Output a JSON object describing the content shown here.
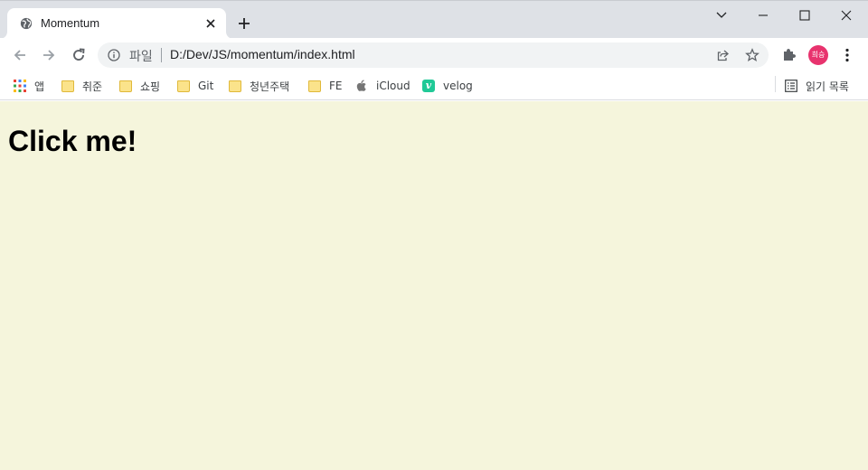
{
  "tab": {
    "title": "Momentum",
    "favicon": "globe-icon",
    "close": "close-icon"
  },
  "toolbar": {
    "scheme_label": "파일",
    "url": "D:/Dev/JS/momentum/index.html",
    "avatar_text": "희승",
    "avatar_color": "#e8336e"
  },
  "bookmarks": [
    {
      "label": "앱",
      "icon": "apps-grid-icon"
    },
    {
      "label": "취준",
      "icon": "folder-icon"
    },
    {
      "label": "쇼핑",
      "icon": "folder-icon"
    },
    {
      "label": "Git",
      "icon": "folder-icon"
    },
    {
      "label": "청년주택",
      "icon": "folder-icon"
    },
    {
      "label": "FE",
      "icon": "folder-icon"
    },
    {
      "label": "iCloud",
      "icon": "apple-icon"
    },
    {
      "label": "velog",
      "icon": "velog-icon",
      "glyph": "v"
    }
  ],
  "reading_list": {
    "label": "읽기 목록",
    "icon": "reading-list-icon"
  },
  "page": {
    "background": "#f5f5dc",
    "headline": "Click me!"
  }
}
